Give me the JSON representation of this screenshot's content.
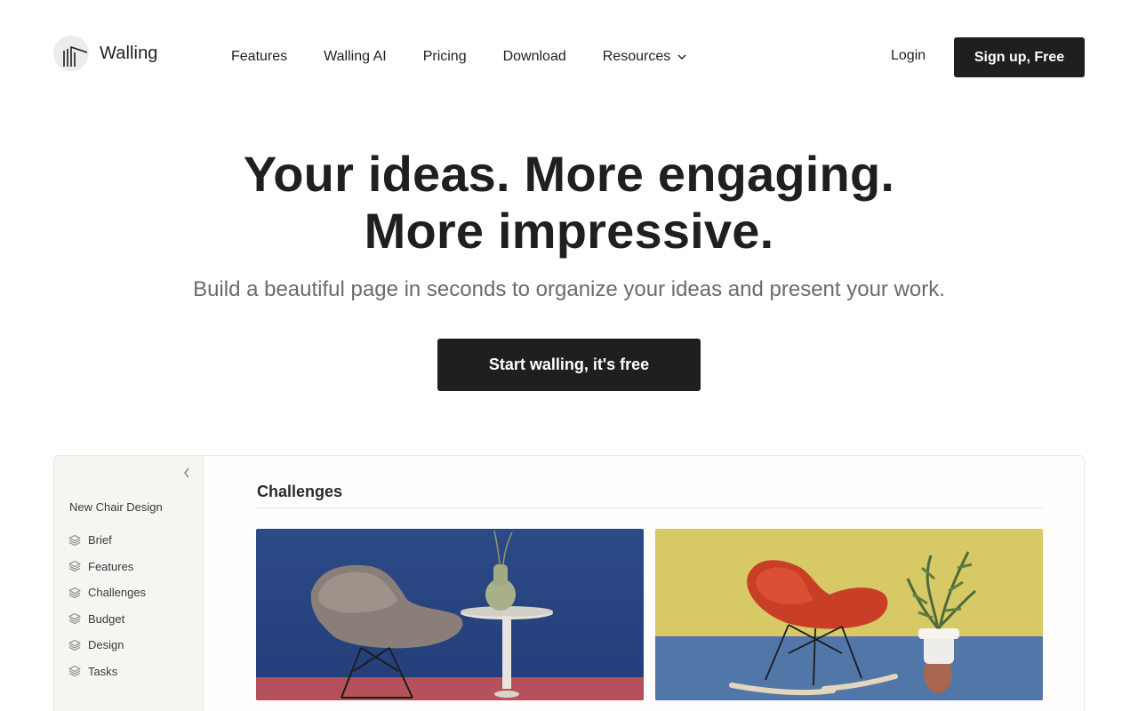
{
  "brand": {
    "name": "Walling"
  },
  "nav": {
    "items": [
      {
        "label": "Features"
      },
      {
        "label": "Walling AI"
      },
      {
        "label": "Pricing"
      },
      {
        "label": "Download"
      },
      {
        "label": "Resources"
      }
    ],
    "login": "Login",
    "signup": "Sign up, Free"
  },
  "hero": {
    "title_line1": "Your ideas. More engaging.",
    "title_line2": "More impressive.",
    "subtitle": "Build a beautiful page in seconds to organize your ideas and present your work.",
    "cta": "Start walling, it's free"
  },
  "preview": {
    "project_title": "New Chair Design",
    "sidebar": [
      {
        "label": "Brief"
      },
      {
        "label": "Features"
      },
      {
        "label": "Challenges"
      },
      {
        "label": "Budget"
      },
      {
        "label": "Design"
      },
      {
        "label": "Tasks"
      }
    ],
    "section_title": "Challenges",
    "images": [
      {
        "name": "grey-chair-blue-background"
      },
      {
        "name": "red-rocking-chair-yellow-background"
      }
    ]
  },
  "colors": {
    "primary": "#1f1f1f",
    "muted_text": "#6b6b6b",
    "sidebar_bg": "#f7f5f1"
  }
}
